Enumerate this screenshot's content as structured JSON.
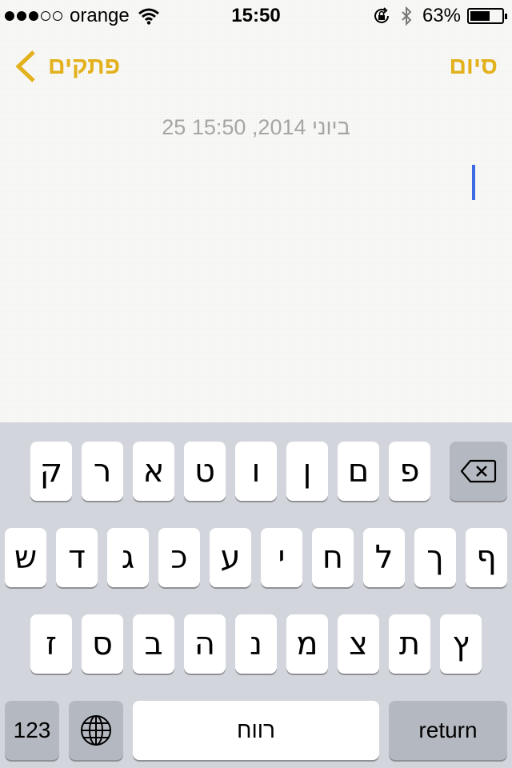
{
  "status_bar": {
    "signal_dots": [
      true,
      true,
      true,
      false,
      false
    ],
    "carrier": "orange",
    "time": "15:50",
    "battery_percent_label": "63%",
    "battery_level": 0.63,
    "icons": [
      "wifi-icon",
      "rotation-lock-icon",
      "bluetooth-icon",
      "battery-icon"
    ]
  },
  "nav": {
    "back_label": "פתקים",
    "done_label": "סיום",
    "accent_color": "#e2b11c"
  },
  "note": {
    "date": "25 ביוני 2014, 15:50",
    "body": ""
  },
  "keyboard": {
    "row1": [
      "ק",
      "ר",
      "א",
      "ט",
      "ו",
      "ן",
      "ם",
      "פ"
    ],
    "row2": [
      "ש",
      "ד",
      "ג",
      "כ",
      "ע",
      "י",
      "ח",
      "ל",
      "ך",
      "ף"
    ],
    "row3": [
      "ז",
      "ס",
      "ב",
      "ה",
      "נ",
      "מ",
      "צ",
      "ת",
      "ץ"
    ],
    "numbers_key": "123",
    "space_key": "רווח",
    "return_key": "return",
    "backspace_icon": "backspace-icon",
    "globe_icon": "globe-icon"
  }
}
